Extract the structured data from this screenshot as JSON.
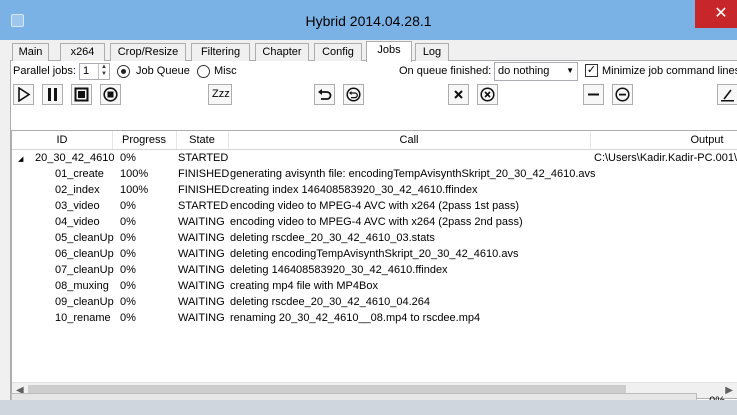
{
  "window": {
    "title": "Hybrid 2014.04.28.1",
    "close_glyph": "✕"
  },
  "tabs": [
    {
      "label": "Main"
    },
    {
      "label": "x264"
    },
    {
      "label": "Crop/Resize"
    },
    {
      "label": "Filtering"
    },
    {
      "label": "Chapter"
    },
    {
      "label": "Config"
    },
    {
      "label": "Jobs",
      "active": true
    },
    {
      "label": "Log"
    }
  ],
  "options": {
    "parallel_label": "Parallel jobs:",
    "parallel_value": "1",
    "job_queue_label": "Job Queue",
    "misc_label": "Misc",
    "selected_mode": "Job Queue",
    "on_finish_label": "On queue finished:",
    "on_finish_value": "do nothing",
    "minimize_label": "Minimize job command lines",
    "minimize_checked": true
  },
  "toolbar": {
    "icons": [
      "start-icon",
      "pause-icon",
      "stop-icon",
      "stop-all-icon",
      "sleep-icon",
      "undo-icon",
      "reset-icon",
      "delete-icon",
      "delete-all-icon",
      "collapse-icon",
      "collapse-all-icon",
      "edit-icon"
    ],
    "sleep_label": "Zzz"
  },
  "table": {
    "columns": [
      "ID",
      "Progress",
      "State",
      "Call",
      "Output"
    ],
    "group": {
      "expander": "◢",
      "id": "20_30_42_4610",
      "progress": "0%",
      "state": "STARTED",
      "call": "",
      "output": "C:\\Users\\Kadir.Kadir-PC.001\\"
    },
    "rows": [
      {
        "id": "01_create",
        "progress": "100%",
        "state": "FINISHED",
        "call": "generating avisynth file: encodingTempAvisynthSkript_20_30_42_4610.avs"
      },
      {
        "id": "02_index",
        "progress": "100%",
        "state": "FINISHED",
        "call": "creating index 146408583920_30_42_4610.ffindex"
      },
      {
        "id": "03_video",
        "progress": "0%",
        "state": "STARTED",
        "call": "encoding video to MPEG-4 AVC with x264 (2pass 1st pass)"
      },
      {
        "id": "04_video",
        "progress": "0%",
        "state": "WAITING",
        "call": "encoding video to MPEG-4 AVC with x264 (2pass 2nd pass)"
      },
      {
        "id": "05_cleanUp",
        "progress": "0%",
        "state": "WAITING",
        "call": "deleting rscdee_20_30_42_4610_03.stats"
      },
      {
        "id": "06_cleanUp",
        "progress": "0%",
        "state": "WAITING",
        "call": "deleting encodingTempAvisynthSkript_20_30_42_4610.avs"
      },
      {
        "id": "07_cleanUp",
        "progress": "0%",
        "state": "WAITING",
        "call": "deleting 146408583920_30_42_4610.ffindex"
      },
      {
        "id": "08_muxing",
        "progress": "0%",
        "state": "WAITING",
        "call": "creating mp4 file with MP4Box"
      },
      {
        "id": "09_cleanUp",
        "progress": "0%",
        "state": "WAITING",
        "call": "deleting rscdee_20_30_42_4610_04.264"
      },
      {
        "id": "10_rename",
        "progress": "0%",
        "state": "WAITING",
        "call": "renaming 20_30_42_4610__08.mp4 to rscdee.mp4"
      }
    ]
  },
  "status": {
    "progress_text": "0%",
    "progress_value": 0
  },
  "colors": {
    "titlebar": "#7ab2e6",
    "close": "#c7262b",
    "bottom_strip": "#cfd6de"
  }
}
